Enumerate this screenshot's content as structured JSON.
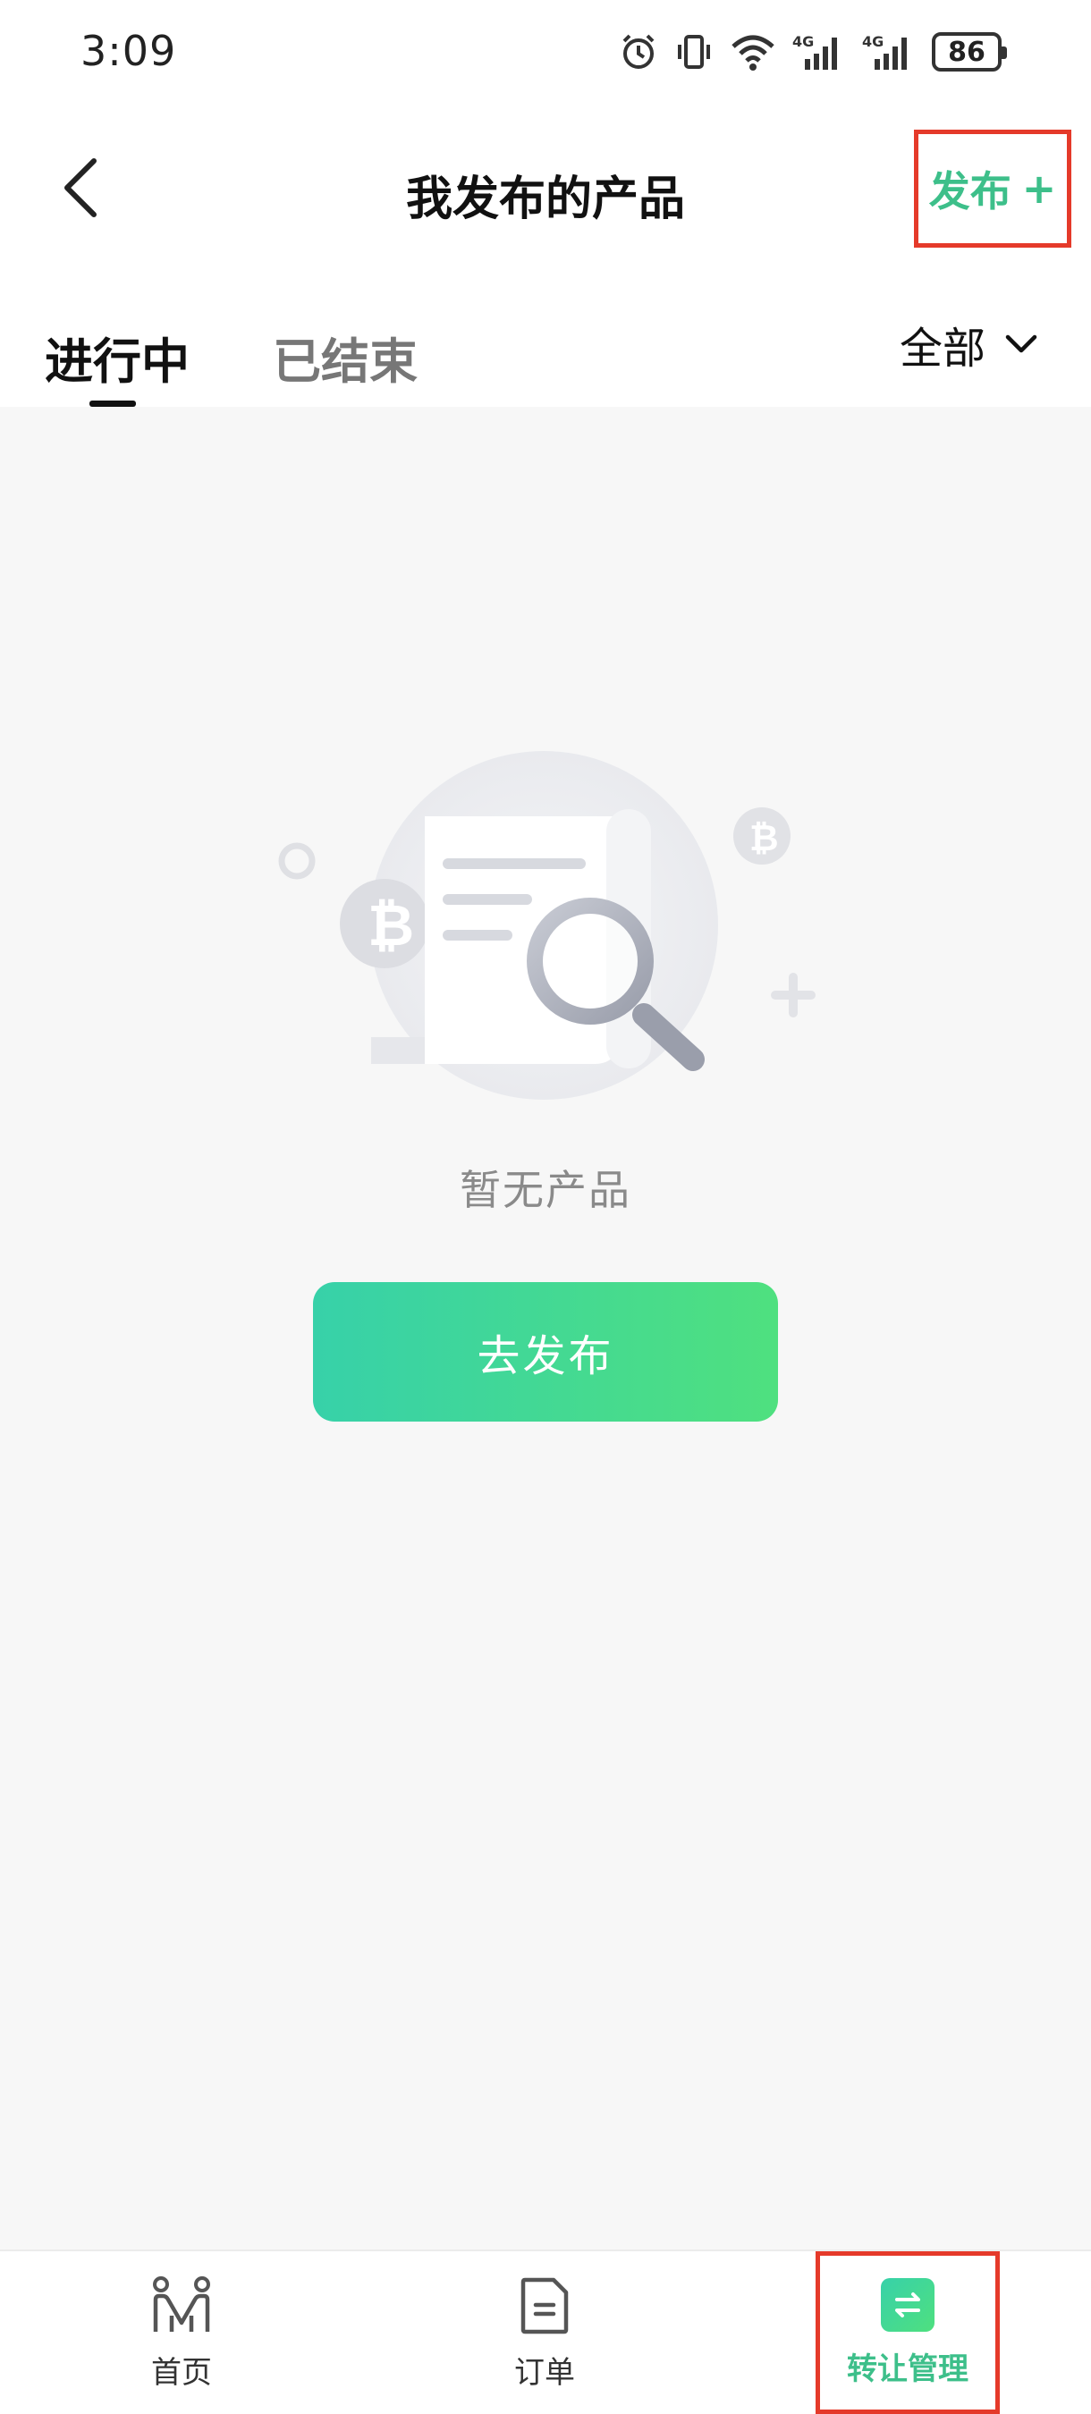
{
  "status_bar": {
    "time": "3:09",
    "network_1": "4G",
    "network_2": "4G",
    "battery": "86",
    "icons": [
      "alarm-icon",
      "vibrate-icon",
      "wifi-icon",
      "signal-4g-icon",
      "signal-4g-icon",
      "battery-icon"
    ]
  },
  "header": {
    "title": "我发布的产品",
    "publish_label": "发布",
    "publish_plus": "+"
  },
  "tabs": {
    "active": "进行中",
    "inactive": "已结束",
    "filter_label": "全部"
  },
  "empty_state": {
    "text": "暂无产品",
    "button_label": "去发布"
  },
  "bottom_nav": {
    "items": [
      {
        "label": "首页",
        "icon": "home-icon"
      },
      {
        "label": "订单",
        "icon": "order-icon"
      },
      {
        "label": "转让管理",
        "icon": "transfer-icon",
        "active": true
      }
    ]
  },
  "colors": {
    "accent": "#3dbf8a",
    "gradient_start": "#37d1a9",
    "gradient_end": "#4fe07f",
    "highlight_border": "#e53a2a",
    "background": "#f7f7f7"
  }
}
